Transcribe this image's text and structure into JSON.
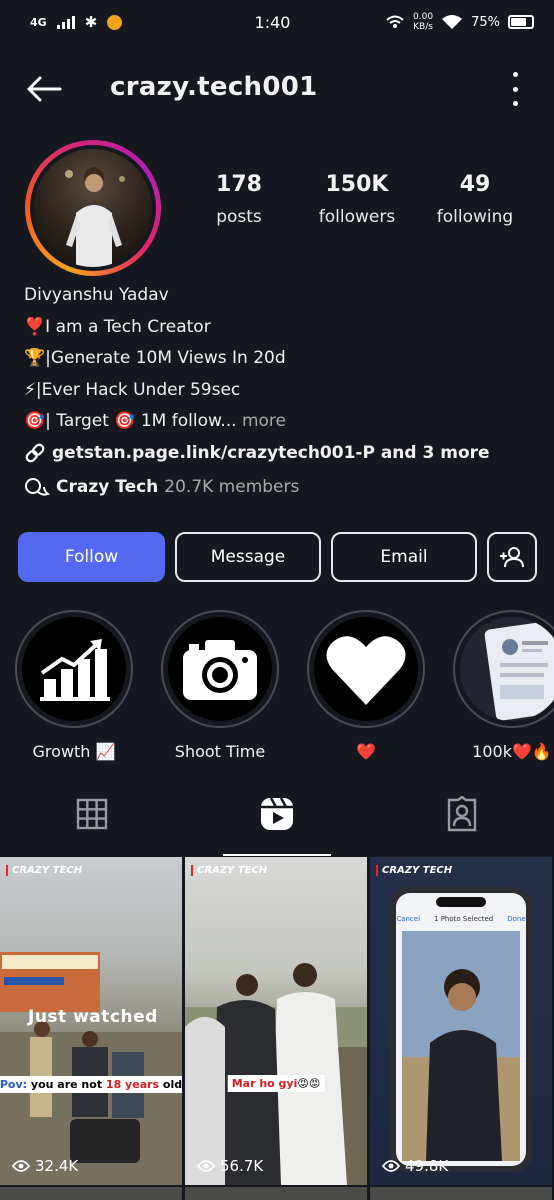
{
  "status_bar": {
    "network": "4G",
    "time": "1:40",
    "speed_value": "0.00",
    "speed_unit": "KB/s",
    "battery": "75%"
  },
  "header": {
    "username": "crazy.tech001",
    "back_icon": "arrow-left-icon",
    "menu_icon": "more-vertical-icon"
  },
  "profile": {
    "stats": [
      {
        "value": "178",
        "label": "posts"
      },
      {
        "value": "150K",
        "label": "followers"
      },
      {
        "value": "49",
        "label": "following"
      }
    ],
    "name": "Divyanshu Yadav",
    "bio_lines": [
      "❣️I am a Tech Creator",
      "🏆|Generate 10M Views In 20d",
      "⚡|Ever Hack Under 59sec",
      "🎯| Target 🎯 1M follow..."
    ],
    "more_label": "more",
    "link_text": "getstan.page.link/crazytech001-P and 3 more",
    "channel_name": "Crazy Tech",
    "channel_members": "20.7K members"
  },
  "actions": {
    "follow": "Follow",
    "message": "Message",
    "email": "Email"
  },
  "highlights": [
    {
      "label": "Growth 📈",
      "icon": "growth-chart-icon"
    },
    {
      "label": "Shoot Time",
      "icon": "camera-icon"
    },
    {
      "label": "❤️",
      "icon": "heart-icon"
    },
    {
      "label": "100k❤️🔥",
      "icon": "screenshot-thumbnail"
    }
  ],
  "tabs": [
    {
      "name": "grid",
      "icon": "grid-icon"
    },
    {
      "name": "reels",
      "icon": "reels-icon",
      "active": true
    },
    {
      "name": "tagged",
      "icon": "tagged-user-icon"
    }
  ],
  "reels": [
    {
      "brand": "CRAZY TECH",
      "caption_pre": "Pov: ",
      "caption_mid": "you are not ",
      "caption_post": "18 years",
      "caption_end": " old",
      "overlay": "Just watched",
      "views": "32.4K"
    },
    {
      "brand": "CRAZY TECH",
      "caption_pre": "Mar ho ",
      "caption_mid": "gyi",
      "caption_end": "😡😡",
      "views": "56.7K"
    },
    {
      "brand": "CRAZY TECH",
      "phone_header": "1 Photo Selected",
      "phone_cancel": "Cancel",
      "phone_done": "Done",
      "views": "49.8K"
    }
  ],
  "colors": {
    "background": "#16181f",
    "follow_button": "#5468f2",
    "muted_text": "#a8a8a8"
  }
}
